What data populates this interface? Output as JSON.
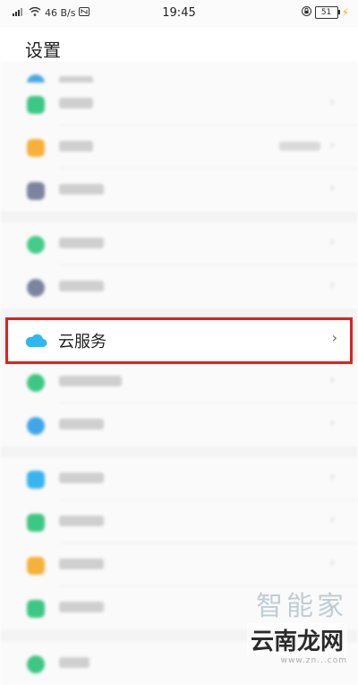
{
  "status_bar": {
    "network_speed": "46 B/s",
    "time": "19:45",
    "battery": "51"
  },
  "header": {
    "title": "设置"
  },
  "highlighted_item": {
    "label": "云服务",
    "chevron": "›",
    "icon": "cloud-icon"
  },
  "watermark": {
    "line1": "智能家",
    "line2": "云南龙网",
    "line3": "www.zn...com"
  },
  "colors": {
    "highlight_border": "#e02020",
    "cloud_icon": "#2fb8f0"
  }
}
